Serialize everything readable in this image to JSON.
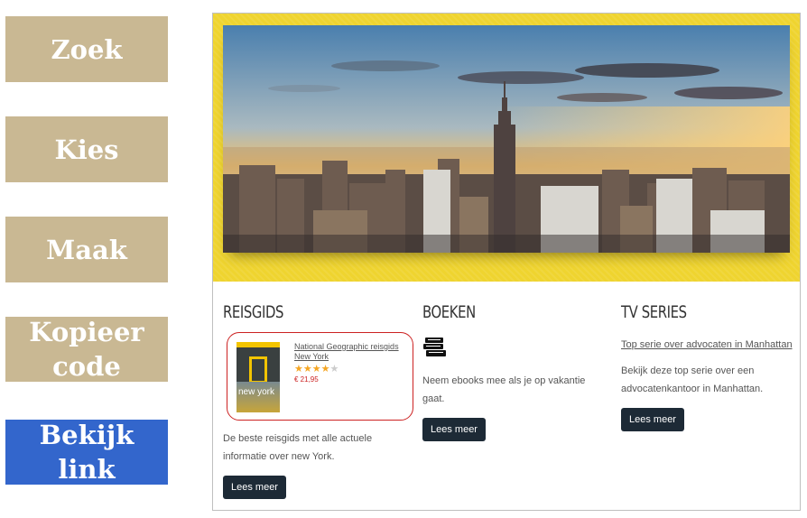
{
  "steps": [
    {
      "label": "Zoek"
    },
    {
      "label": "Kies"
    },
    {
      "label": "Maak"
    },
    {
      "label": "Kopieer code"
    },
    {
      "label": "Bekijk link"
    }
  ],
  "colors": {
    "step_inactive": "#c9b893",
    "step_active": "#3366cc",
    "hero_band": "#efd42f",
    "button": "#1d2a36",
    "highlight_border": "#cc2222"
  },
  "preview": {
    "hero_image": "new-york-skyline",
    "columns": [
      {
        "title": "REISGIDS",
        "product": {
          "cover_title": "new york",
          "link": "National Geographic reisgids New York",
          "rating": 4,
          "rating_max": 5,
          "price": "€ 21,95"
        },
        "text_lines": [
          "De beste reisgids met alle actuele",
          "informatie over new York."
        ],
        "button": "Lees meer"
      },
      {
        "title": "BOEKEN",
        "icon": "books-icon",
        "text_lines": [
          "Neem ebooks mee als je op vakantie gaat."
        ],
        "button": "Lees meer"
      },
      {
        "title": "TV SERIES",
        "link": "Top serie over advocaten in Manhattan",
        "text_lines": [
          "Bekijk deze top serie over een",
          "advocatenkantoor in Manhattan."
        ],
        "button": "Lees meer"
      }
    ]
  }
}
